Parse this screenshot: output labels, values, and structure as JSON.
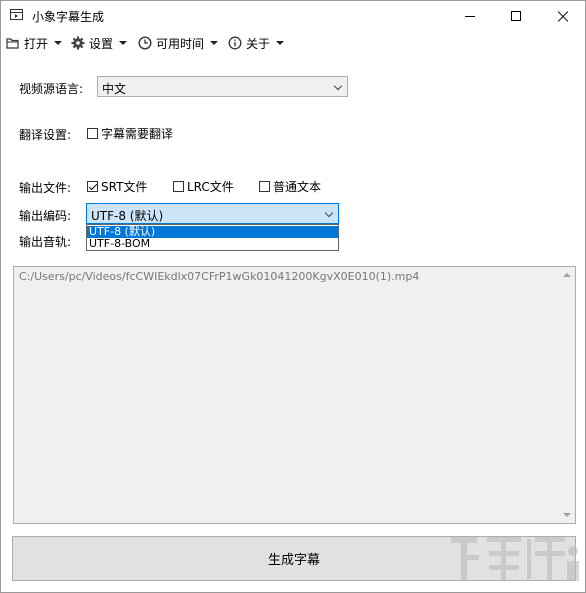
{
  "window": {
    "title": "小象字幕生成"
  },
  "menu": {
    "open": "打开",
    "settings": "设置",
    "available_time": "可用时间",
    "about": "关于"
  },
  "form": {
    "source_lang_label": "视频源语言:",
    "source_lang_value": "中文",
    "translate_label": "翻译设置:",
    "translate_checkbox": "字幕需要翻译",
    "output_file_label": "输出文件:",
    "output_files": [
      "SRT文件",
      "LRC文件",
      "普通文本"
    ],
    "output_files_checked": [
      true,
      false,
      false
    ],
    "encoding_label": "输出编码:",
    "encoding_value": "UTF-8  (默认)",
    "encoding_options": [
      "UTF-8  (默认)",
      "UTF-8-BOM"
    ],
    "audio_track_label": "输出音轨:"
  },
  "file_list": [
    "C:/Users/pc/Videos/fcCWIEkdlx07CFrP1wGk01041200KgvX0E010(1).mp4"
  ],
  "generate_button": "生成字幕",
  "colors": {
    "accent": "#0078d7",
    "dropdown_bg": "#cce4f7",
    "panel": "#f0f0f0"
  }
}
